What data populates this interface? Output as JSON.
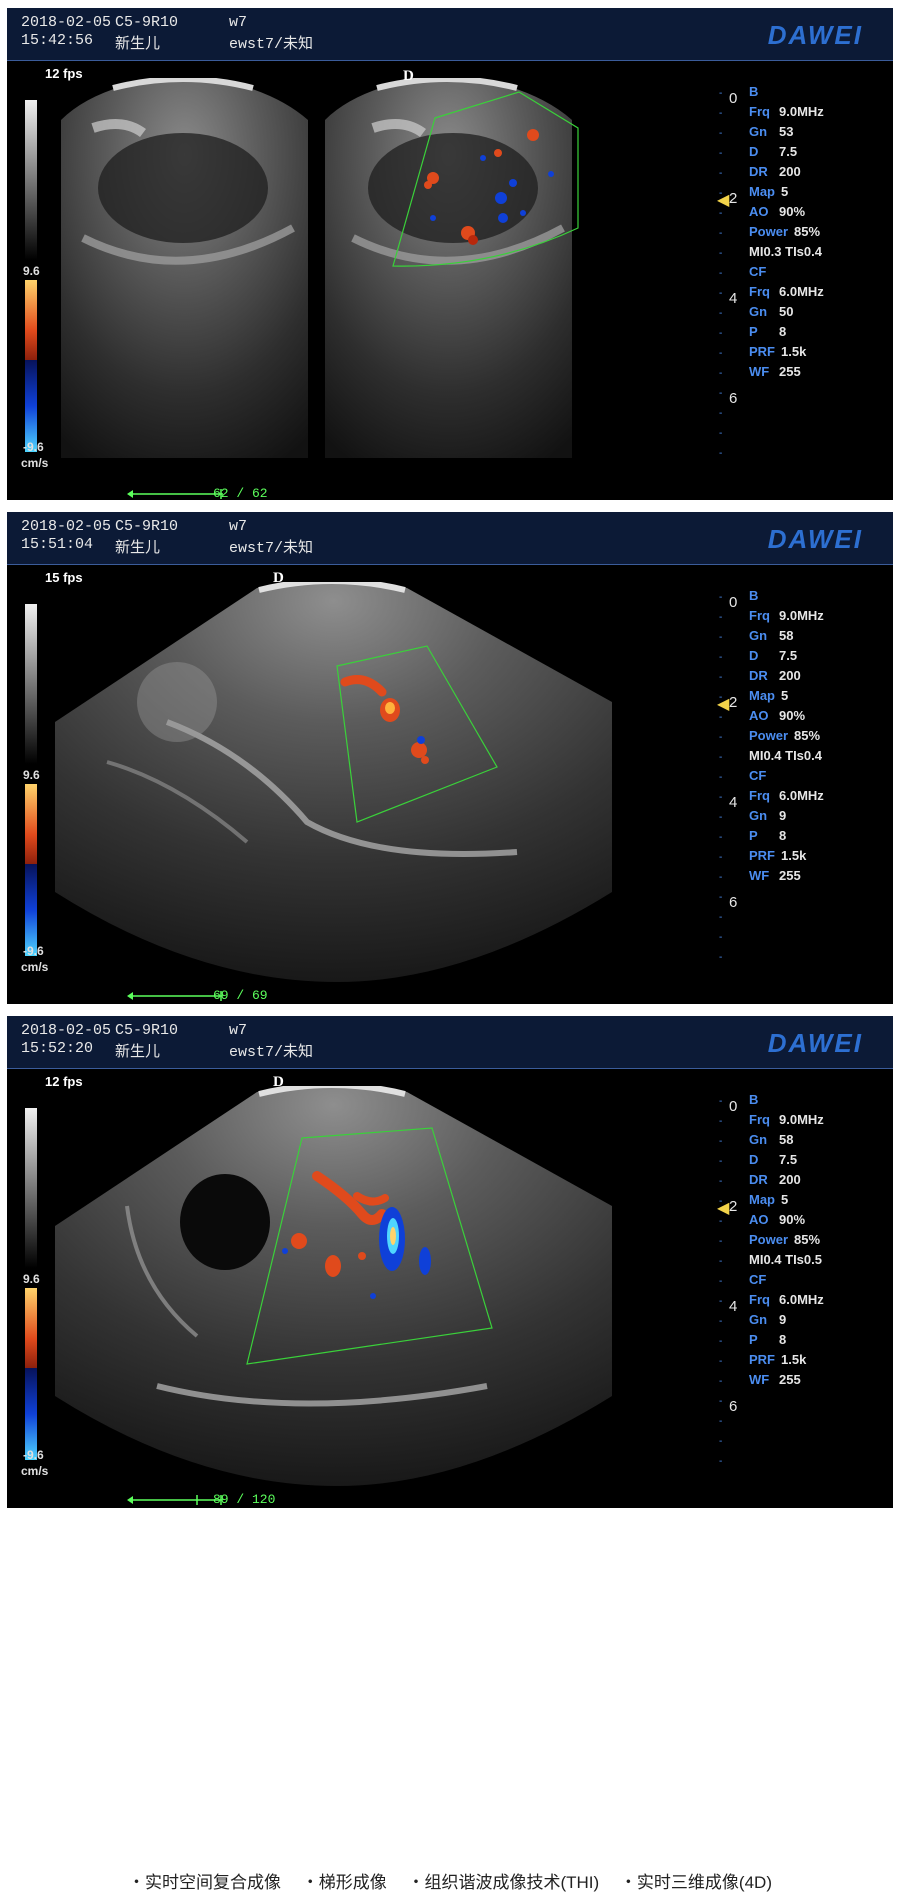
{
  "panels": [
    {
      "date": "2018-02-05",
      "probe": "C5-9R10",
      "preset": "w7",
      "time": "15:42:56",
      "patient_type": "新生儿",
      "exam": "ewst7/未知",
      "logo": "DAWEI",
      "fps": "12 fps",
      "scale_top": "9.6",
      "scale_bottom": "-9.6",
      "scale_unit": "cm/s",
      "d_marker": "D",
      "params": {
        "b_label": "B",
        "frq_label": "Frq",
        "frq": "9.0MHz",
        "gn_label": "Gn",
        "gn": "53",
        "d_label": "D",
        "d": "7.5",
        "dr_label": "DR",
        "dr": "200",
        "map_label": "Map",
        "map": "5",
        "ao_label": "AO",
        "ao": "90%",
        "power_label": "Power",
        "power": "85%",
        "mi_ti": "MI0.3 TIs0.4",
        "cf_label": "CF",
        "cf_frq_label": "Frq",
        "cf_frq": "6.0MHz",
        "cf_gn_label": "Gn",
        "cf_gn": "50",
        "p_label": "P",
        "p": "8",
        "prf_label": "PRF",
        "prf": "1.5k",
        "wf_label": "WF",
        "wf": "255"
      },
      "depth_labels": [
        "0",
        "2",
        "4",
        "6"
      ],
      "cine": "62 / 62"
    },
    {
      "date": "2018-02-05",
      "probe": "C5-9R10",
      "preset": "w7",
      "time": "15:51:04",
      "patient_type": "新生儿",
      "exam": "ewst7/未知",
      "logo": "DAWEI",
      "fps": "15 fps",
      "scale_top": "9.6",
      "scale_bottom": "-9.6",
      "scale_unit": "cm/s",
      "d_marker": "D",
      "params": {
        "b_label": "B",
        "frq_label": "Frq",
        "frq": "9.0MHz",
        "gn_label": "Gn",
        "gn": "58",
        "d_label": "D",
        "d": "7.5",
        "dr_label": "DR",
        "dr": "200",
        "map_label": "Map",
        "map": "5",
        "ao_label": "AO",
        "ao": "90%",
        "power_label": "Power",
        "power": "85%",
        "mi_ti": "MI0.4 TIs0.4",
        "cf_label": "CF",
        "cf_frq_label": "Frq",
        "cf_frq": "6.0MHz",
        "cf_gn_label": "Gn",
        "cf_gn": "9",
        "p_label": "P",
        "p": "8",
        "prf_label": "PRF",
        "prf": "1.5k",
        "wf_label": "WF",
        "wf": "255"
      },
      "depth_labels": [
        "0",
        "2",
        "4",
        "6"
      ],
      "cine": "69 / 69"
    },
    {
      "date": "2018-02-05",
      "probe": "C5-9R10",
      "preset": "w7",
      "time": "15:52:20",
      "patient_type": "新生儿",
      "exam": "ewst7/未知",
      "logo": "DAWEI",
      "fps": "12 fps",
      "scale_top": "9.6",
      "scale_bottom": "-9.6",
      "scale_unit": "cm/s",
      "d_marker": "D",
      "params": {
        "b_label": "B",
        "frq_label": "Frq",
        "frq": "9.0MHz",
        "gn_label": "Gn",
        "gn": "58",
        "d_label": "D",
        "d": "7.5",
        "dr_label": "DR",
        "dr": "200",
        "map_label": "Map",
        "map": "5",
        "ao_label": "AO",
        "ao": "90%",
        "power_label": "Power",
        "power": "85%",
        "mi_ti": "MI0.4 TIs0.5",
        "cf_label": "CF",
        "cf_frq_label": "Frq",
        "cf_frq": "6.0MHz",
        "cf_gn_label": "Gn",
        "cf_gn": "9",
        "p_label": "P",
        "p": "8",
        "prf_label": "PRF",
        "prf": "1.5k",
        "wf_label": "WF",
        "wf": "255"
      },
      "depth_labels": [
        "0",
        "2",
        "4",
        "6"
      ],
      "cine": "89 / 120"
    }
  ],
  "footer": [
    "・实时空间复合成像",
    "・梯形成像",
    "・组织谐波成像技术(THI)",
    "・实时三维成像(4D)"
  ],
  "colors": {
    "header_bg": "#0c1a36",
    "logo": "#2d6fd1",
    "param_label": "#4b8df0",
    "roi_box": "#3ad13a",
    "cine": "#5cff5c",
    "doppler_red": "#e04a1c",
    "doppler_blue": "#0f40d8"
  }
}
